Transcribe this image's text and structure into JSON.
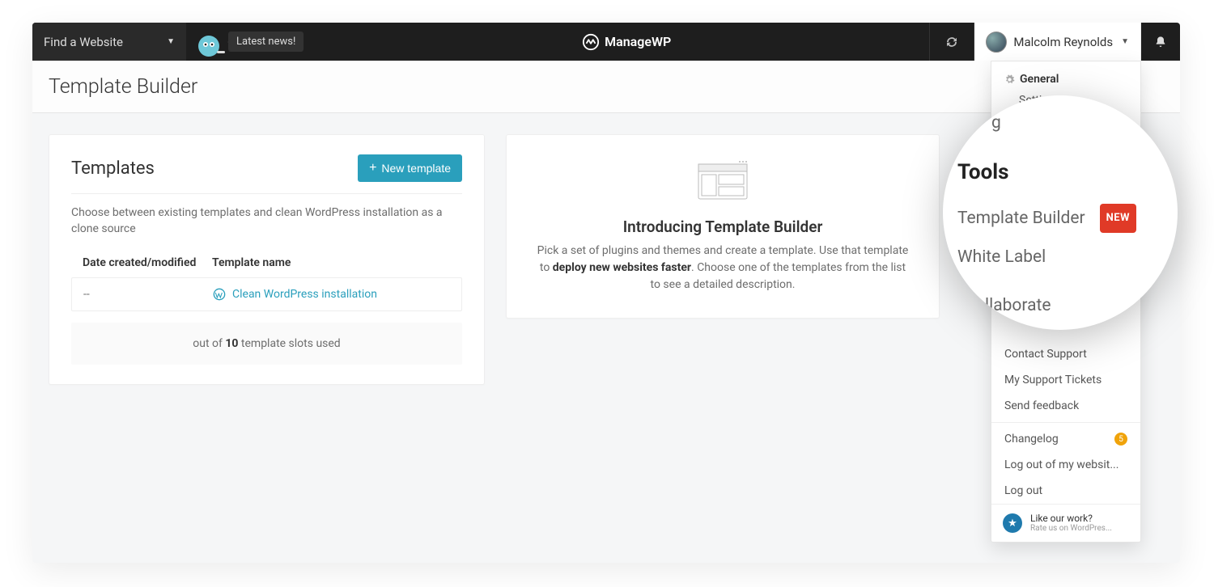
{
  "topbar": {
    "find_label": "Find a Website",
    "news_label": "Latest news!",
    "brand": "ManageWP",
    "user_name": "Malcolm Reynolds"
  },
  "page": {
    "title": "Template Builder"
  },
  "templates": {
    "heading": "Templates",
    "new_button": "New template",
    "description": "Choose between existing templates and clean WordPress installation as a clone source",
    "col_date": "Date created/modified",
    "col_name": "Template name",
    "rows": [
      {
        "date": "--",
        "name": "Clean WordPress installation"
      }
    ],
    "slots_prefix": "out of ",
    "slots_total": "10",
    "slots_suffix": " template slots used"
  },
  "intro": {
    "title": "Introducing Template Builder",
    "text_1": "Pick a set of plugins and themes and create a template. Use that template to ",
    "text_bold": "deploy new websites faster",
    "text_2": ". Choose one of the templates from the list to see a detailed description."
  },
  "dropdown": {
    "general": "General",
    "settings": "Settings",
    "contact_support": "Contact Support",
    "my_tickets": "My Support Tickets",
    "send_feedback": "Send feedback",
    "changelog": "Changelog",
    "changelog_count": "5",
    "logout_sites": "Log out of my websit...",
    "logout": "Log out",
    "rate_title": "Like our work?",
    "rate_sub": "Rate us on WordPres..."
  },
  "zoom": {
    "top_clip": "g",
    "heading": "Tools",
    "item1": "Template Builder",
    "badge": "NEW",
    "item2": "White Label",
    "bottom_clip": "llaborate"
  }
}
